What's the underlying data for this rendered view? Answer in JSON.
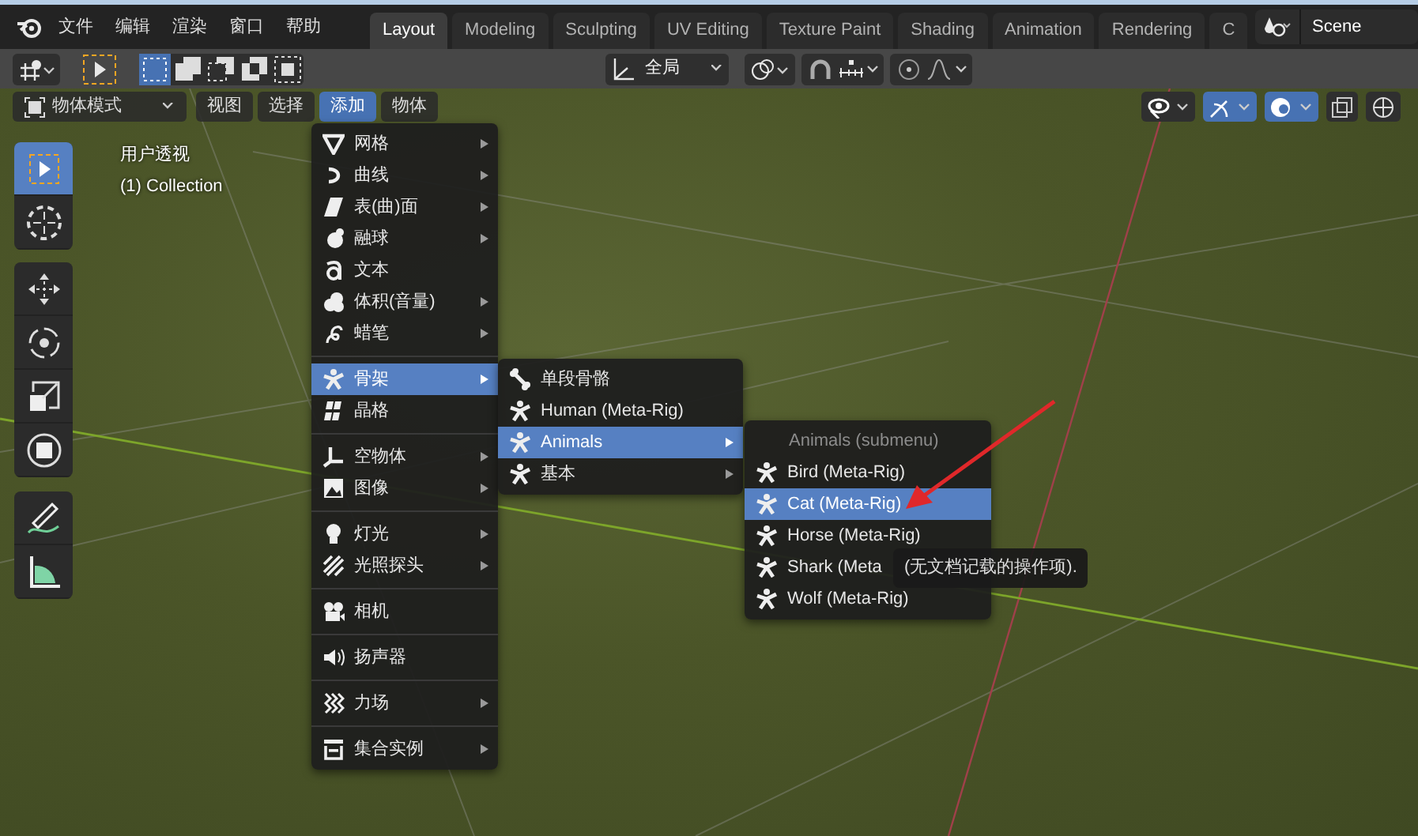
{
  "menu_bar": [
    "文件",
    "编辑",
    "渲染",
    "窗口",
    "帮助"
  ],
  "workspace_tabs": [
    {
      "label": "Layout",
      "selected": true
    },
    {
      "label": "Modeling",
      "selected": false
    },
    {
      "label": "Sculpting",
      "selected": false
    },
    {
      "label": "UV Editing",
      "selected": false
    },
    {
      "label": "Texture Paint",
      "selected": false
    },
    {
      "label": "Shading",
      "selected": false
    },
    {
      "label": "Animation",
      "selected": false
    },
    {
      "label": "Rendering",
      "selected": false
    },
    {
      "label": "C",
      "selected": false
    }
  ],
  "scene": {
    "name": "Scene"
  },
  "tool_header": {
    "orientation": "全局"
  },
  "viewport_header": {
    "mode": "物体模式",
    "menus": [
      {
        "label": "视图",
        "selected": false
      },
      {
        "label": "选择",
        "selected": false
      },
      {
        "label": "添加",
        "selected": true
      },
      {
        "label": "物体",
        "selected": false
      }
    ]
  },
  "viewport_overlay": {
    "view_name": "用户透视",
    "collection": "(1) Collection"
  },
  "toolbar_groups": [
    {
      "tools": [
        {
          "kind": "select",
          "selected": true
        },
        {
          "kind": "cursor",
          "selected": false
        }
      ]
    },
    {
      "tools": [
        {
          "kind": "move",
          "selected": false
        },
        {
          "kind": "rotate",
          "selected": false
        },
        {
          "kind": "scale",
          "selected": false
        },
        {
          "kind": "transform",
          "selected": false
        }
      ]
    },
    {
      "tools": [
        {
          "kind": "annotate",
          "selected": false
        },
        {
          "kind": "measure",
          "selected": false
        }
      ]
    }
  ],
  "add_menu": {
    "items": [
      {
        "kind": "mesh",
        "label": "网格",
        "submenu": true,
        "selected": false
      },
      {
        "kind": "curve",
        "label": "曲线",
        "submenu": true,
        "selected": false
      },
      {
        "kind": "surface",
        "label": "表(曲)面",
        "submenu": true,
        "selected": false
      },
      {
        "kind": "metaball",
        "label": "融球",
        "submenu": true,
        "selected": false
      },
      {
        "kind": "text",
        "label": "文本",
        "submenu": false,
        "selected": false
      },
      {
        "kind": "volume",
        "label": "体积(音量)",
        "submenu": true,
        "selected": false
      },
      {
        "kind": "grease_pencil",
        "label": "蜡笔",
        "submenu": true,
        "selected": false
      },
      {
        "kind": "separator"
      },
      {
        "kind": "armature",
        "label": "骨架",
        "submenu": true,
        "selected": true
      },
      {
        "kind": "lattice",
        "label": "晶格",
        "submenu": false,
        "selected": false
      },
      {
        "kind": "separator"
      },
      {
        "kind": "empty",
        "label": "空物体",
        "submenu": true,
        "selected": false
      },
      {
        "kind": "image",
        "label": "图像",
        "submenu": true,
        "selected": false
      },
      {
        "kind": "separator"
      },
      {
        "kind": "light",
        "label": "灯光",
        "submenu": true,
        "selected": false
      },
      {
        "kind": "light_probe",
        "label": "光照探头",
        "submenu": true,
        "selected": false
      },
      {
        "kind": "separator"
      },
      {
        "kind": "camera",
        "label": "相机",
        "submenu": false,
        "selected": false
      },
      {
        "kind": "separator"
      },
      {
        "kind": "speaker",
        "label": "扬声器",
        "submenu": false,
        "selected": false
      },
      {
        "kind": "separator"
      },
      {
        "kind": "force_field",
        "label": "力场",
        "submenu": true,
        "selected": false
      },
      {
        "kind": "separator"
      },
      {
        "kind": "collection",
        "label": "集合实例",
        "submenu": true,
        "selected": false
      }
    ]
  },
  "armature_menu": {
    "items": [
      {
        "kind": "bone",
        "label": "单段骨骼",
        "submenu": false,
        "selected": false
      },
      {
        "kind": "armature",
        "label": "Human (Meta-Rig)",
        "submenu": false,
        "selected": false
      },
      {
        "kind": "armature",
        "label": "Animals",
        "submenu": true,
        "selected": true
      },
      {
        "kind": "armature",
        "label": "基本",
        "submenu": true,
        "selected": false
      }
    ]
  },
  "animals_menu": {
    "items": [
      {
        "kind": "header",
        "label": "Animals (submenu)"
      },
      {
        "kind": "armature",
        "label": "Bird (Meta-Rig)",
        "submenu": false,
        "selected": false
      },
      {
        "kind": "armature",
        "label": "Cat (Meta-Rig)",
        "submenu": false,
        "selected": true
      },
      {
        "kind": "armature",
        "label": "Horse (Meta-Rig)",
        "submenu": false,
        "selected": false
      },
      {
        "kind": "armature",
        "label": "Shark (Meta",
        "submenu": false,
        "selected": false
      },
      {
        "kind": "armature",
        "label": "Wolf (Meta-Rig)",
        "submenu": false,
        "selected": false
      }
    ]
  },
  "tooltip": {
    "text": "(无文档记载的操作项)."
  }
}
